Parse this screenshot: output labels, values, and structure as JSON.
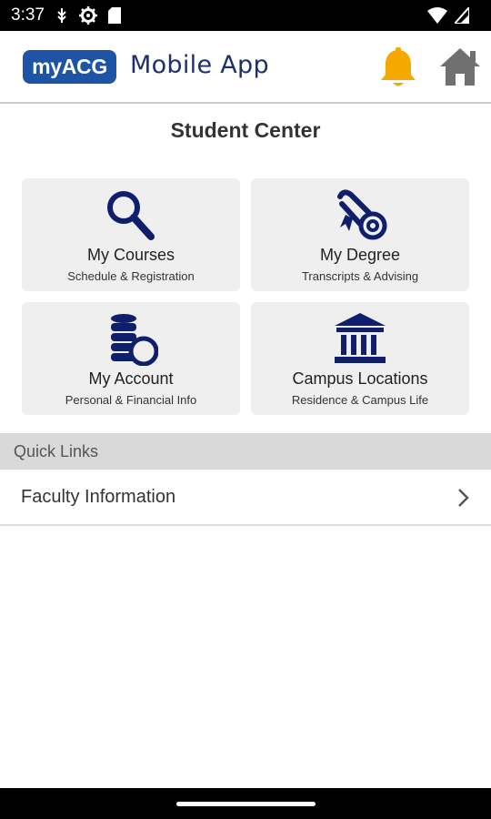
{
  "status_bar": {
    "time": "3:37",
    "icons": [
      "usb-debug-icon",
      "settings-cog-icon",
      "sd-card-icon",
      "wifi-icon",
      "signal-icon",
      "battery-icon"
    ]
  },
  "header": {
    "logo_text": "myACG",
    "app_name": "Mobile App",
    "notification_icon": "bell-icon",
    "home_icon": "home-icon",
    "brand_color": "#1d54a6",
    "bell_color": "#f5a800"
  },
  "page": {
    "title": "Student Center"
  },
  "tiles": [
    {
      "label": "My Courses",
      "sub": "Schedule & Registration",
      "icon": "magnifier-icon"
    },
    {
      "label": "My Degree",
      "sub": "Transcripts & Advising",
      "icon": "diploma-icon"
    },
    {
      "label": "My Account",
      "sub": "Personal & Financial Info",
      "icon": "coins-icon"
    },
    {
      "label": "Campus Locations",
      "sub": "Residence & Campus Life",
      "icon": "building-icon"
    }
  ],
  "quick_links": {
    "header": "Quick Links",
    "items": [
      {
        "label": "Faculty Information"
      }
    ]
  },
  "colors": {
    "icon_navy": "#0f1f6b",
    "tile_bg": "#efefef"
  }
}
